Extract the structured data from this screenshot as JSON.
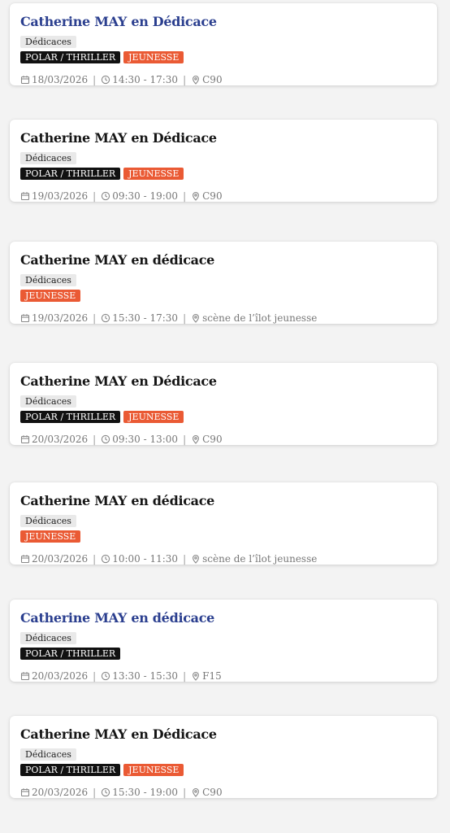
{
  "events": [
    {
      "title": "Catherine MAY en Dédicace",
      "title_is_link": true,
      "category": "Dédicaces",
      "tags": [
        {
          "label": "POLAR / THRILLER",
          "color": "#111111"
        },
        {
          "label": "JEUNESSE",
          "color": "#ea5a34"
        }
      ],
      "date": "18/03/2026",
      "time": "14:30 - 17:30",
      "location": "C90"
    },
    {
      "title": "Catherine MAY en Dédicace",
      "title_is_link": false,
      "category": "Dédicaces",
      "tags": [
        {
          "label": "POLAR / THRILLER",
          "color": "#111111"
        },
        {
          "label": "JEUNESSE",
          "color": "#ea5a34"
        }
      ],
      "date": "19/03/2026",
      "time": "09:30 - 19:00",
      "location": "C90"
    },
    {
      "title": "Catherine MAY en dédicace",
      "title_is_link": false,
      "category": "Dédicaces",
      "tags": [
        {
          "label": "JEUNESSE",
          "color": "#ea5a34"
        }
      ],
      "date": "19/03/2026",
      "time": "15:30 - 17:30",
      "location": "scène de l’îlot jeunesse"
    },
    {
      "title": "Catherine MAY en Dédicace",
      "title_is_link": false,
      "category": "Dédicaces",
      "tags": [
        {
          "label": "POLAR / THRILLER",
          "color": "#111111"
        },
        {
          "label": "JEUNESSE",
          "color": "#ea5a34"
        }
      ],
      "date": "20/03/2026",
      "time": "09:30 - 13:00",
      "location": "C90"
    },
    {
      "title": "Catherine MAY en dédicace",
      "title_is_link": false,
      "category": "Dédicaces",
      "tags": [
        {
          "label": "JEUNESSE",
          "color": "#ea5a34"
        }
      ],
      "date": "20/03/2026",
      "time": "10:00 - 11:30",
      "location": "scène de l’îlot jeunesse"
    },
    {
      "title": "Catherine MAY en dédicace",
      "title_is_link": true,
      "category": "Dédicaces",
      "tags": [
        {
          "label": "POLAR / THRILLER",
          "color": "#111111"
        }
      ],
      "date": "20/03/2026",
      "time": "13:30 - 15:30",
      "location": "F15"
    },
    {
      "title": "Catherine MAY en Dédicace",
      "title_is_link": false,
      "category": "Dédicaces",
      "tags": [
        {
          "label": "POLAR / THRILLER",
          "color": "#111111"
        },
        {
          "label": "JEUNESSE",
          "color": "#ea5a34"
        }
      ],
      "date": "20/03/2026",
      "time": "15:30 - 19:00",
      "location": "C90"
    }
  ],
  "icons": {
    "date": "calendar-icon",
    "time": "clock-icon",
    "location": "map-pin-icon"
  },
  "colors": {
    "link_title": "#2b3f8f",
    "title": "#161616",
    "category_badge_bg": "#e9e9e9",
    "meta_text": "#777777"
  }
}
